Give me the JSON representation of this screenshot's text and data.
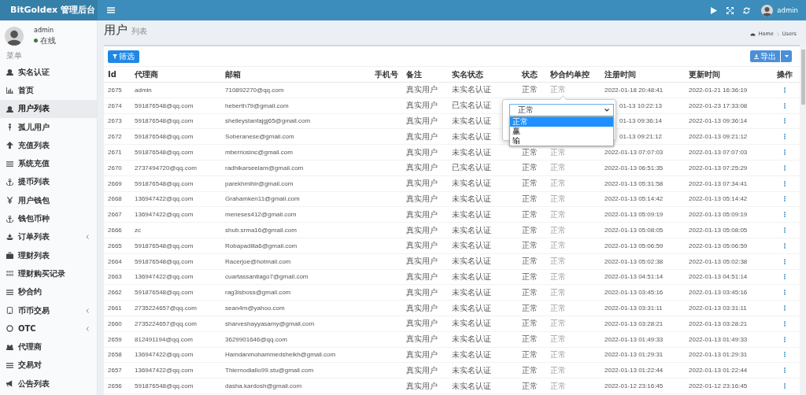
{
  "header": {
    "brand": "BitGoldex 管理后台",
    "user_name": "admin"
  },
  "user_panel": {
    "name": "admin",
    "status": "在线"
  },
  "sidebar": {
    "heading": "菜单",
    "items": [
      {
        "label": "实名认证",
        "selected": false,
        "has_submenu": false
      },
      {
        "label": "首页",
        "selected": false,
        "has_submenu": false
      },
      {
        "label": "用户列表",
        "selected": true,
        "has_submenu": false
      },
      {
        "label": "孤儿用户",
        "selected": false,
        "has_submenu": false
      },
      {
        "label": "充值列表",
        "selected": false,
        "has_submenu": false
      },
      {
        "label": "系统充值",
        "selected": false,
        "has_submenu": false
      },
      {
        "label": "提币列表",
        "selected": false,
        "has_submenu": false
      },
      {
        "label": "用户钱包",
        "selected": false,
        "has_submenu": false
      },
      {
        "label": "钱包币种",
        "selected": false,
        "has_submenu": false
      },
      {
        "label": "订单列表",
        "selected": false,
        "has_submenu": true
      },
      {
        "label": "理财列表",
        "selected": false,
        "has_submenu": false
      },
      {
        "label": "理财购买记录",
        "selected": false,
        "has_submenu": false
      },
      {
        "label": "秒合约",
        "selected": false,
        "has_submenu": false
      },
      {
        "label": "币币交易",
        "selected": false,
        "has_submenu": true
      },
      {
        "label": "OTC",
        "selected": false,
        "has_submenu": true
      },
      {
        "label": "代理商",
        "selected": false,
        "has_submenu": false
      },
      {
        "label": "交易对",
        "selected": false,
        "has_submenu": false
      },
      {
        "label": "公告列表",
        "selected": false,
        "has_submenu": false
      }
    ]
  },
  "page": {
    "title": "用户",
    "subtitle": "列表",
    "breadcrumb": [
      "Home",
      "Users"
    ]
  },
  "toolbar": {
    "filter": "筛选",
    "export": "导出"
  },
  "table": {
    "columns": [
      "Id",
      "代理商",
      "邮箱",
      "手机号",
      "备注",
      "实名状态",
      "状态",
      "秒合约单控",
      "注册时间",
      "更新时间",
      "操作"
    ],
    "rows": [
      {
        "id": "2675",
        "agent": "admin",
        "email": "710892270@qq.com",
        "remark": "真实用户",
        "verify": "未实名认证",
        "status": "正常",
        "control": "正常",
        "created": "2022-01-18 20:48:41",
        "updated": "2022-01-21 16:36:19"
      },
      {
        "id": "2674",
        "agent": "591876548@qq.com",
        "email": "heberth79@gmail.com",
        "remark": "真实用户",
        "verify": "已实名认证",
        "created": "01-13 10:22:13",
        "updated": "2022-01-23 17:33:08"
      },
      {
        "id": "2673",
        "agent": "591876548@qq.com",
        "email": "shelleystanfajgj65@gmail.com",
        "remark": "真实用户",
        "verify": "未实名认证",
        "created": "01-13 09:36:14",
        "updated": "2022-01-13 09:36:14"
      },
      {
        "id": "2672",
        "agent": "591876548@qq.com",
        "email": "Soberanese@gmail.com",
        "remark": "真实用户",
        "verify": "未实名认证",
        "created": "01-13 09:21:12",
        "updated": "2022-01-13 09:21:12"
      },
      {
        "id": "2671",
        "agent": "591876548@qq.com",
        "email": "mberriosinc@gmail.com",
        "remark": "真实用户",
        "verify": "未实名认证",
        "status": "正常",
        "control": "正常",
        "created": "2022-01-13 07:07:03",
        "updated": "2022-01-13 07:07:03"
      },
      {
        "id": "2670",
        "agent": "2737494720@qq.com",
        "email": "radhikarseelam@gmail.com",
        "remark": "真实用户",
        "verify": "已实名认证",
        "status": "正常",
        "control": "正常",
        "created": "2022-01-13 06:51:35",
        "updated": "2022-01-13 07:25:29"
      },
      {
        "id": "2669",
        "agent": "591876548@qq.com",
        "email": "parekhmihir@gmail.com",
        "remark": "真实用户",
        "verify": "未实名认证",
        "status": "正常",
        "control": "正常",
        "created": "2022-01-13 05:31:58",
        "updated": "2022-01-13 07:34:41"
      },
      {
        "id": "2668",
        "agent": "136947422@qq.com",
        "email": "Grahamken11@gmail.com",
        "remark": "真实用户",
        "verify": "未实名认证",
        "status": "正常",
        "control": "正常",
        "created": "2022-01-13 05:14:42",
        "updated": "2022-01-13 05:14:42"
      },
      {
        "id": "2667",
        "agent": "136947422@qq.com",
        "email": "meneses412@gmail.com",
        "remark": "真实用户",
        "verify": "未实名认证",
        "status": "正常",
        "control": "正常",
        "created": "2022-01-13 05:09:19",
        "updated": "2022-01-13 05:09:19"
      },
      {
        "id": "2666",
        "agent": "zc",
        "email": "shub.srma16@gmail.com",
        "remark": "真实用户",
        "verify": "未实名认证",
        "status": "正常",
        "control": "正常",
        "created": "2022-01-13 05:08:05",
        "updated": "2022-01-13 05:08:05"
      },
      {
        "id": "2665",
        "agent": "591876548@qq.com",
        "email": "Robapadilla6@gmail.com",
        "remark": "真实用户",
        "verify": "未实名认证",
        "status": "正常",
        "control": "正常",
        "created": "2022-01-13 05:06:59",
        "updated": "2022-01-13 05:06:59"
      },
      {
        "id": "2664",
        "agent": "591876548@qq.com",
        "email": "Racerjoe@hotmail.com",
        "remark": "真实用户",
        "verify": "未实名认证",
        "status": "正常",
        "control": "正常",
        "created": "2022-01-13 05:02:38",
        "updated": "2022-01-13 05:02:38"
      },
      {
        "id": "2663",
        "agent": "136947422@qq.com",
        "email": "cuartassantiago7@gmail.com",
        "remark": "真实用户",
        "verify": "未实名认证",
        "status": "正常",
        "control": "正常",
        "created": "2022-01-13 04:51:14",
        "updated": "2022-01-13 04:51:14"
      },
      {
        "id": "2662",
        "agent": "591876548@qq.com",
        "email": "rag3isboss@gmail.com",
        "remark": "真实用户",
        "verify": "未实名认证",
        "status": "正常",
        "control": "正常",
        "created": "2022-01-13 03:45:16",
        "updated": "2022-01-13 03:45:16"
      },
      {
        "id": "2661",
        "agent": "2735224657@qq.com",
        "email": "sean4m@yahoo.com",
        "remark": "真实用户",
        "verify": "未实名认证",
        "status": "正常",
        "control": "正常",
        "created": "2022-01-13 03:31:11",
        "updated": "2022-01-13 03:31:11"
      },
      {
        "id": "2660",
        "agent": "2735224657@qq.com",
        "email": "sharveshayyasamy@gmail.com",
        "remark": "真实用户",
        "verify": "未实名认证",
        "status": "正常",
        "control": "正常",
        "created": "2022-01-13 03:28:21",
        "updated": "2022-01-13 03:28:21"
      },
      {
        "id": "2659",
        "agent": "812491194@qq.com",
        "email": "3629901646@qq.com",
        "remark": "真实用户",
        "verify": "未实名认证",
        "status": "正常",
        "control": "正常",
        "created": "2022-01-13 01:49:33",
        "updated": "2022-01-13 01:49:33"
      },
      {
        "id": "2658",
        "agent": "136947422@qq.com",
        "email": "Hamdanmohammedsheikh@gmail.com",
        "remark": "真实用户",
        "verify": "未实名认证",
        "status": "正常",
        "control": "正常",
        "created": "2022-01-13 01:29:31",
        "updated": "2022-01-13 01:29:31"
      },
      {
        "id": "2657",
        "agent": "136947422@qq.com",
        "email": "Thiernodiallo99.stu@gmail.com",
        "remark": "真实用户",
        "verify": "未实名认证",
        "status": "正常",
        "control": "正常",
        "created": "2022-01-13 01:22:44",
        "updated": "2022-01-13 01:22:44"
      },
      {
        "id": "2656",
        "agent": "591876548@qq.com",
        "email": "dasha.kardosh@gmail.com",
        "remark": "真实用户",
        "verify": "未实名认证",
        "status": "正常",
        "control": "正常",
        "created": "2022-01-12 23:16:45",
        "updated": "2022-01-12 23:16:45"
      }
    ]
  },
  "popover": {
    "value": "正常",
    "options": [
      {
        "label": "正常",
        "selected": true
      },
      {
        "label": "赢",
        "selected": false
      },
      {
        "label": "输",
        "selected": false
      }
    ]
  }
}
